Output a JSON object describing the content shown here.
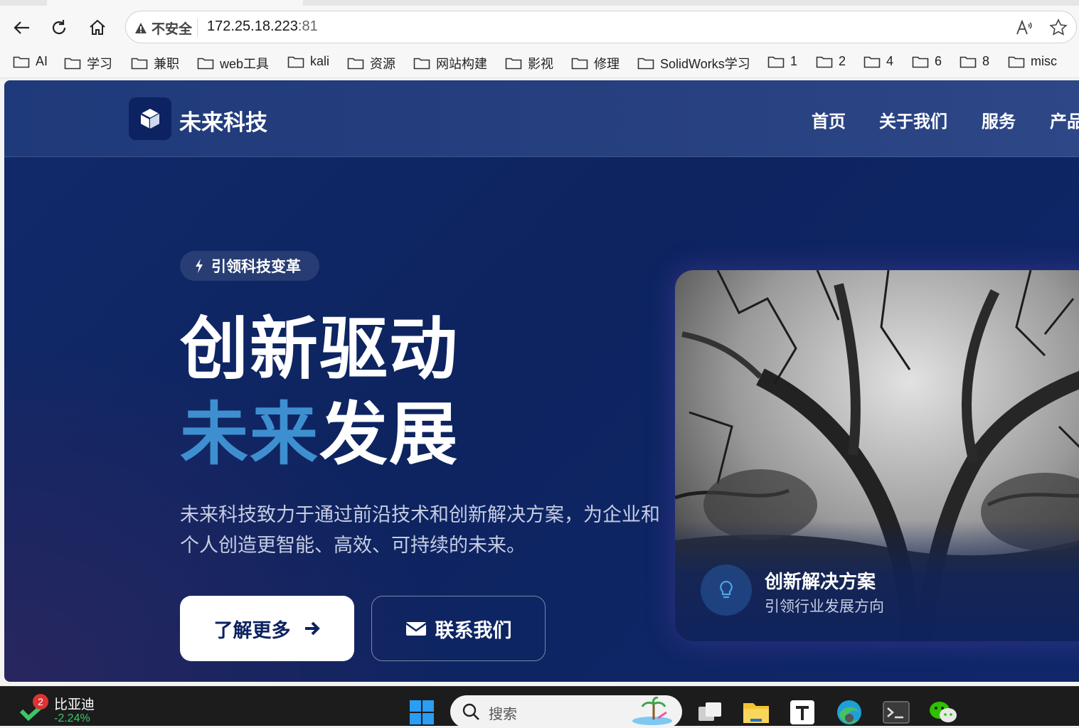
{
  "browser": {
    "security_label": "不安全",
    "url_host": "172.25.18.223",
    "url_port": ":81",
    "bookmarks": [
      "AI",
      "学习",
      "兼职",
      "web工具",
      "kali",
      "资源",
      "网站构建",
      "影视",
      "修理",
      "SolidWorks学习",
      "1",
      "2",
      "4",
      "6",
      "8",
      "misc"
    ]
  },
  "site": {
    "brand": "未来科技",
    "nav": [
      "首页",
      "关于我们",
      "服务",
      "产品"
    ],
    "badge": "引领科技变革",
    "headline_line1": "创新驱动",
    "headline_accent": "未来",
    "headline_rest": "发展",
    "description": "未来科技致力于通过前沿技术和创新解决方案，为企业和个人创造更智能、高效、可持续的未来。",
    "primary_button": "了解更多",
    "secondary_button": "联系我们",
    "card_title": "创新解决方案",
    "card_subtitle": "引领行业发展方向"
  },
  "taskbar": {
    "stock_name": "比亚迪",
    "stock_change": "-2.24%",
    "stock_badge": "2",
    "search_placeholder": "搜索"
  },
  "colors": {
    "accent": "#3e8fd0",
    "page_bg": "#0d2460",
    "header_bg": "#27407f"
  }
}
